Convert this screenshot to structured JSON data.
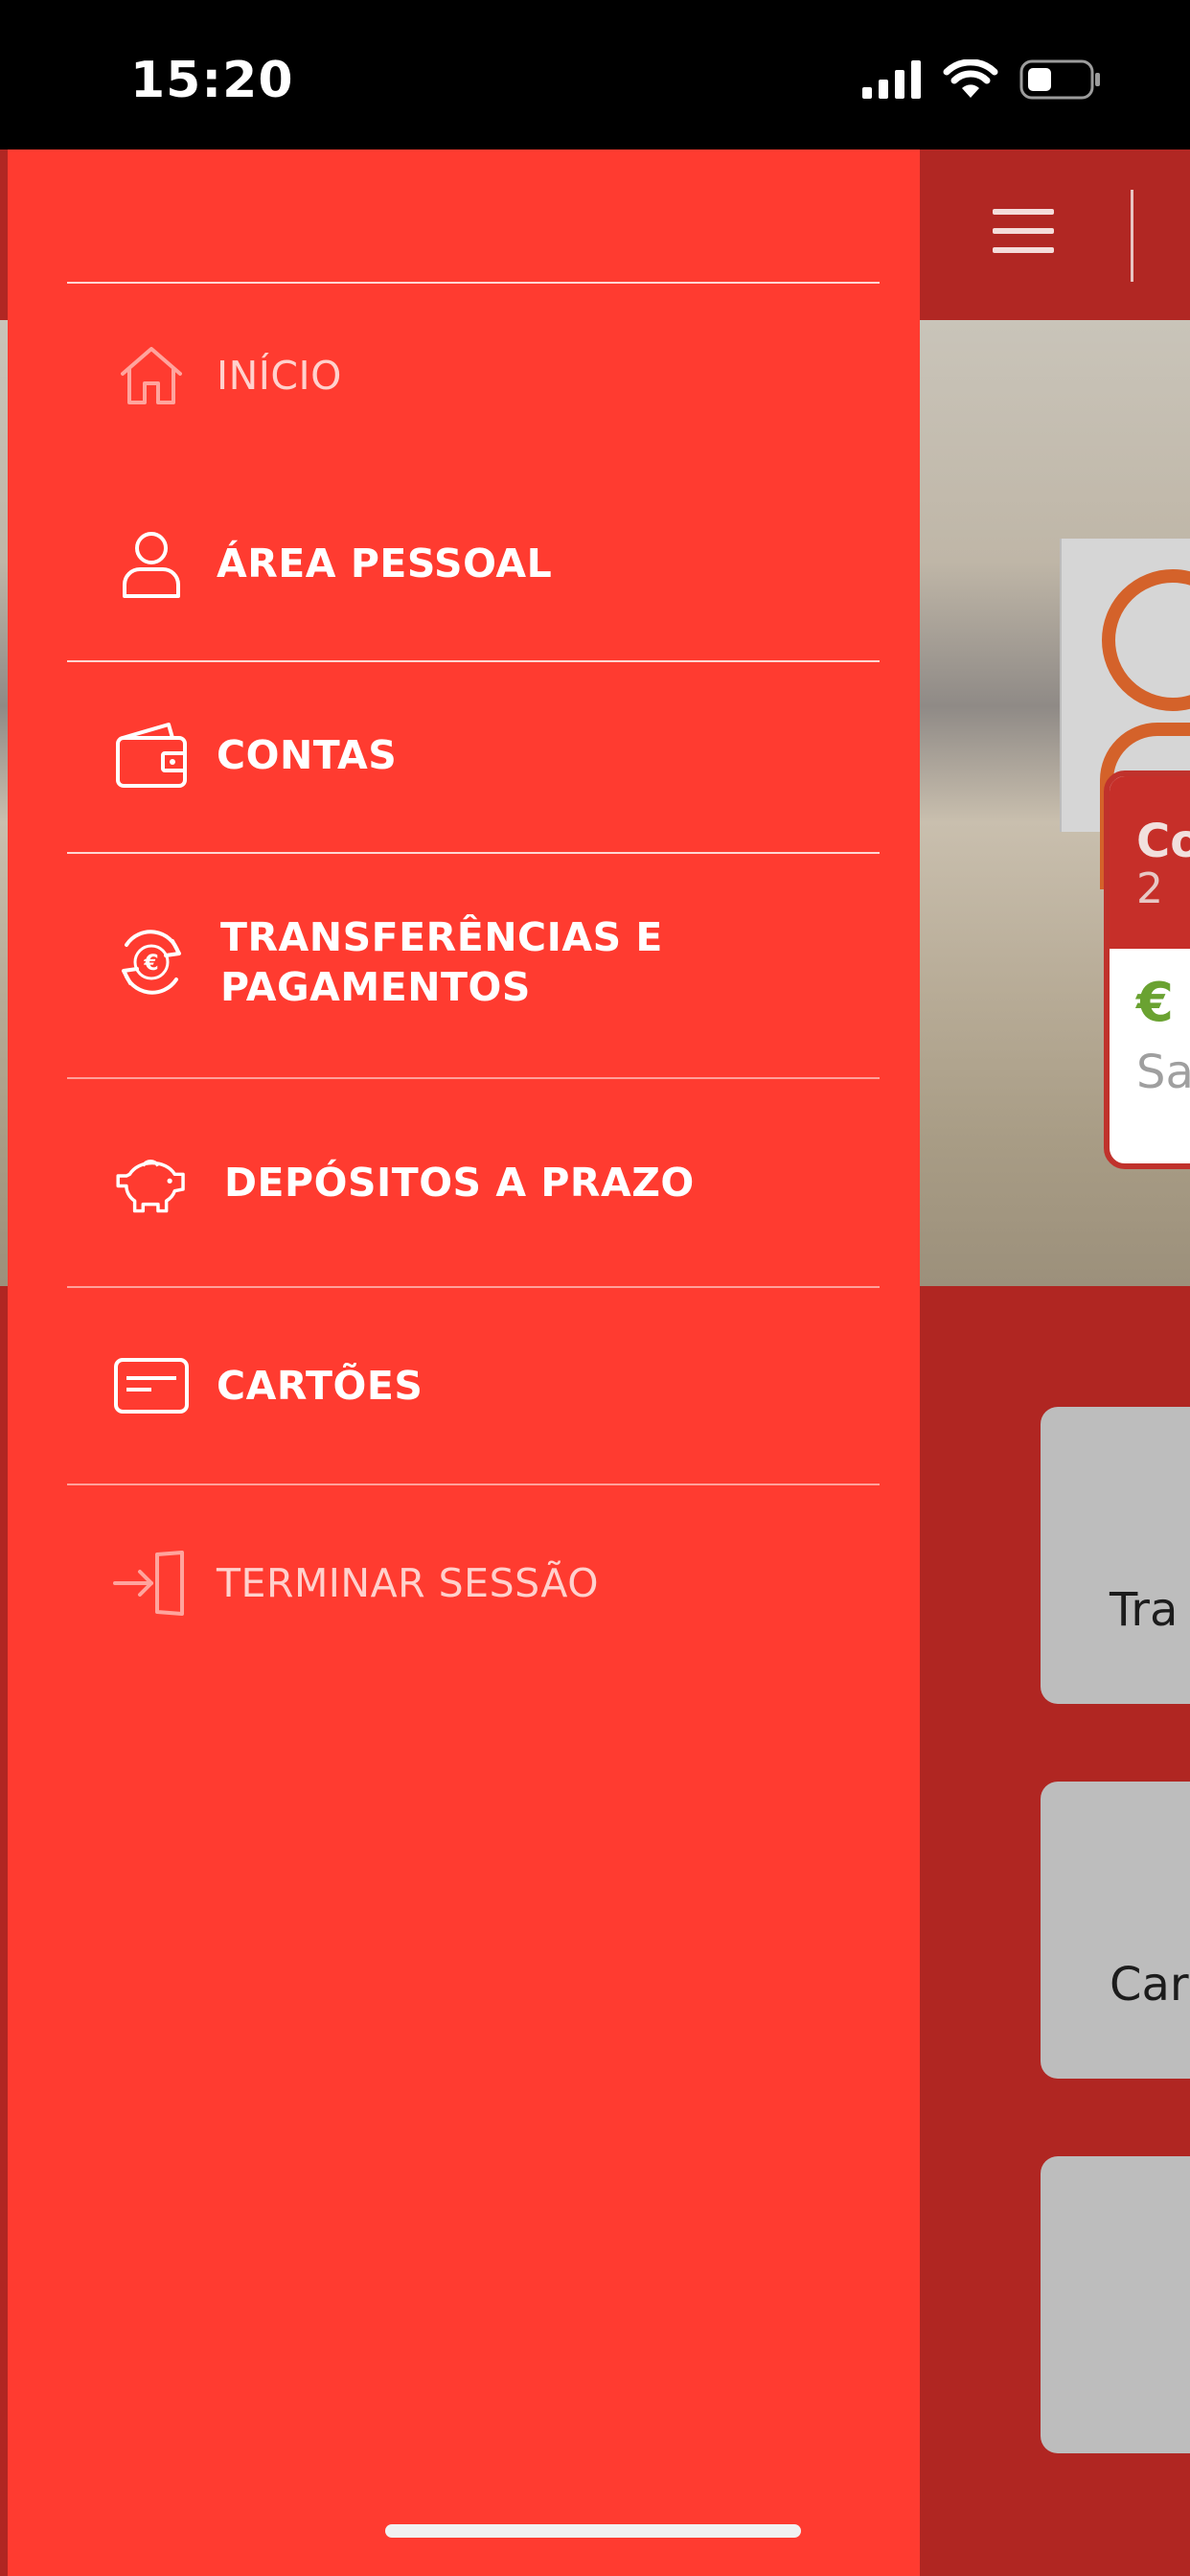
{
  "status_bar": {
    "time": "15:20"
  },
  "background": {
    "account_card_title": "Co",
    "account_card_sub": "2",
    "account_card_currency": "€",
    "account_card_label": "Sa",
    "tiles": [
      "Tra",
      "Car",
      ""
    ]
  },
  "drawer": {
    "items": [
      {
        "label": "INÍCIO",
        "icon": "home-icon",
        "active": false
      },
      {
        "label": "ÁREA PESSOAL",
        "icon": "user-icon",
        "active": true
      },
      {
        "label": "CONTAS",
        "icon": "wallet-icon",
        "active": true
      },
      {
        "label": "TRANSFERÊNCIAS E",
        "label2": "PAGAMENTOS",
        "icon": "euro-transfer-icon",
        "active": true
      },
      {
        "label": "DEPÓSITOS A PRAZO",
        "icon": "piggy-bank-icon",
        "active": true
      },
      {
        "label": "CARTÕES",
        "icon": "card-icon",
        "active": true
      },
      {
        "label": "TERMINAR SESSÃO",
        "icon": "logout-icon",
        "active": false
      }
    ]
  },
  "colors": {
    "drawer_bg": "#ff3b30",
    "header_bg": "#b12723",
    "accent_green": "#6aa231"
  }
}
